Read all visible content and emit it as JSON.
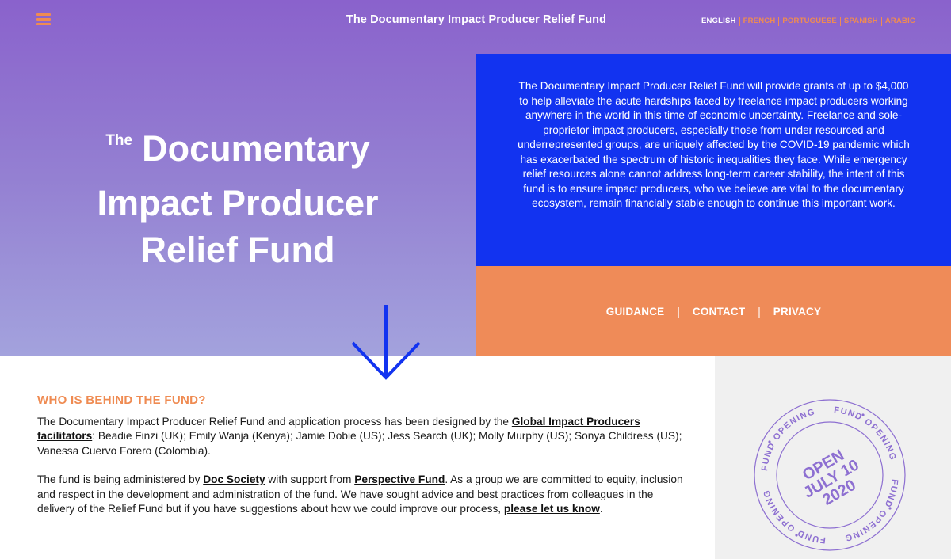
{
  "header": {
    "title": "The Documentary Impact Producer Relief Fund",
    "languages": {
      "english": "ENGLISH",
      "french": "FRENCH",
      "portuguese": "PORTUGUESE",
      "spanish": "SPANISH",
      "arabic": "ARABIC"
    },
    "active_language": "english"
  },
  "hero": {
    "heading_small": "The",
    "heading_line1": "Documentary",
    "heading_line2": "Impact Producer",
    "heading_line3": "Relief Fund",
    "intro": "The Documentary Impact Producer Relief Fund will provide grants of up to $4,000 to help alleviate the acute hardships faced by freelance impact producers working anywhere in the world in this time of economic uncertainty. Freelance and sole-proprietor impact producers, especially those from under resourced and underrepresented groups, are uniquely affected by the COVID-19 pandemic which has exacerbated the spectrum of historic inequalities they face. While emergency relief resources alone cannot address long-term career stability, the intent of this fund is to ensure impact producers, who we believe are vital to the documentary ecosystem, remain financially stable enough to continue this important work.",
    "links": {
      "guidance": "GUIDANCE",
      "contact": "CONTACT",
      "privacy": "PRIVACY",
      "separator": "|"
    }
  },
  "about": {
    "heading": "WHO IS BEHIND THE FUND?",
    "p1_before": "The Documentary Impact Producer Relief Fund and application process has been designed by the ",
    "p1_link": "Global Impact Producers facilitators",
    "p1_after": ": Beadie Finzi (UK); Emily Wanja (Kenya); Jamie Dobie (US); Jess Search (UK); Molly Murphy (US); Sonya Childress (US); Vanessa Cuervo Forero (Colombia).",
    "p2_a": "The fund is being administered by ",
    "p2_link1": "Doc Society",
    "p2_b": " with support from ",
    "p2_link2": "Perspective Fund",
    "p2_c": ". As a group we are committed to equity, inclusion and respect in the development and administration of the fund. We have sought advice and best practices from colleagues in the delivery of the Relief Fund but if you have suggestions about how we could improve our process, ",
    "p2_link3": "please let us know",
    "p2_d": "."
  },
  "badge": {
    "ring_text": "FUND OPENING",
    "line1": "OPEN",
    "line2": "JULY 10",
    "line3": "2020"
  },
  "colors": {
    "accent_orange": "#ef8b52",
    "intro_blue": "#1233f0",
    "badge_purple": "#8d6fd1",
    "hero_gradient_top": "#8a62cc",
    "hero_gradient_bottom": "#a3a2dd"
  },
  "icons": {
    "menu": "hamburger-menu-icon",
    "scroll": "arrow-down-icon"
  }
}
